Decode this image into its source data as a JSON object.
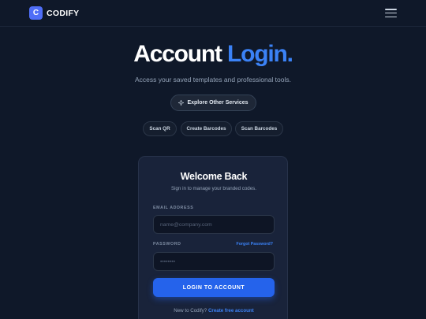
{
  "header": {
    "logo_letter": "C",
    "logo_text": "CODIFY",
    "menu_icon": "hamburger-menu-icon"
  },
  "hero": {
    "title_main": "Account",
    "title_accent": "Login.",
    "subtitle": "Access your saved templates and professional tools."
  },
  "explore": {
    "label": "Explore Other Services",
    "icon": "sparkle-icon"
  },
  "services": [
    {
      "label": "Scan QR"
    },
    {
      "label": "Create Barcodes"
    },
    {
      "label": "Scan Barcodes"
    }
  ],
  "login_card": {
    "title": "Welcome Back",
    "subtitle": "Sign in to manage your branded codes.",
    "email_label": "EMAIL ADDRESS",
    "email_placeholder": "name@company.com",
    "password_label": "PASSWORD",
    "forgot_label": "Forgot Password?",
    "password_placeholder": "••••••••",
    "submit_label": "LOGIN TO ACCOUNT",
    "signup_prompt": "New to Codify?",
    "signup_link": "Create free account"
  },
  "colors": {
    "background": "#0f1829",
    "accent": "#3b82f6",
    "button": "#2563eb",
    "card": "#19233a"
  }
}
